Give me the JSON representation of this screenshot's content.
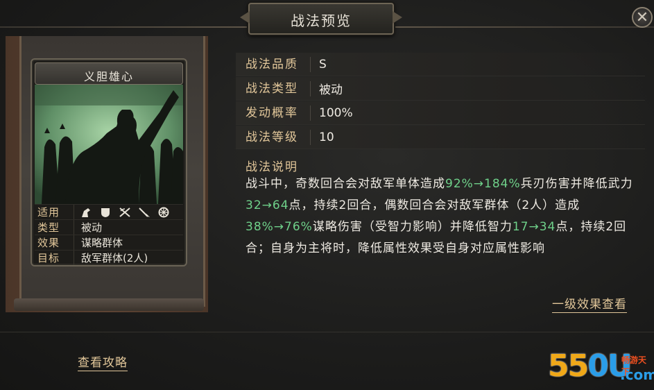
{
  "window": {
    "title": "战法预览",
    "close_glyph": "✕"
  },
  "card": {
    "name": "义胆雄心",
    "rows": {
      "suitable_label": "适用",
      "suitable_icons": [
        "cavalry-icon",
        "shield-icon",
        "bow-icon",
        "spear-icon",
        "wheel-icon"
      ],
      "type_label": "类型",
      "type_value": "被动",
      "effect_label": "效果",
      "effect_value": "谋略群体",
      "target_label": "目标",
      "target_value": "敌军群体(2人)"
    }
  },
  "props": [
    {
      "label": "战法品质",
      "value": "S"
    },
    {
      "label": "战法类型",
      "value": "被动"
    },
    {
      "label": "发动概率",
      "value": "100%"
    },
    {
      "label": "战法等级",
      "value": "10"
    }
  ],
  "description": {
    "heading": "战法说明",
    "parts": [
      {
        "t": "战斗中，奇数回合会对敌军单体造成",
        "hl": false
      },
      {
        "t": "92%→184%",
        "hl": true
      },
      {
        "t": "兵刃伤害并降低武力",
        "hl": false
      },
      {
        "t": "32→64",
        "hl": true
      },
      {
        "t": "点，持续2回合，偶数回合会对敌军群体（2人）造成",
        "hl": false
      },
      {
        "t": "38%→76%",
        "hl": true
      },
      {
        "t": "谋略伤害（受智力影响）并降低智力",
        "hl": false
      },
      {
        "t": "17→34",
        "hl": true
      },
      {
        "t": "点，持续2回合；自身为主将时，降低属性效果受自身对应属性影响",
        "hl": false
      }
    ]
  },
  "links": {
    "level_one_effect": "一级效果查看",
    "view_guide": "查看攻略"
  },
  "watermark": {
    "num": "55",
    "u": "0U",
    "cn": "畅游天下",
    "com": ".com"
  },
  "colors": {
    "label_gold": "#e2c79a",
    "highlight_green": "#6fd18a",
    "art_green": "#6d9c72"
  }
}
